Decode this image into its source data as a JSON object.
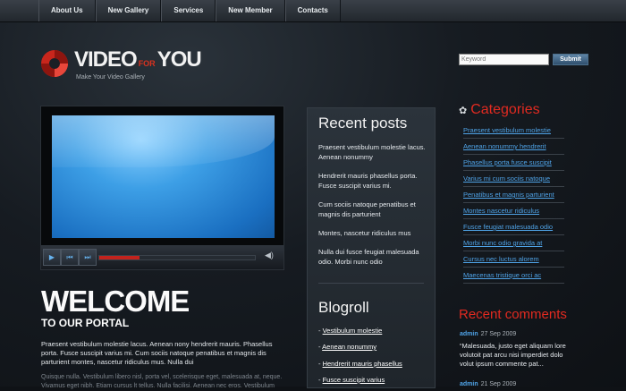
{
  "nav": [
    "About Us",
    "New Gallery",
    "Services",
    "New Member",
    "Contacts"
  ],
  "logo": {
    "video": "VIDEO",
    "for": "FOR",
    "you": "YOU",
    "tagline": "Make Your Video Gallery"
  },
  "search": {
    "placeholder": "Keyword",
    "button": "Submit"
  },
  "player": {
    "play_icon": "▶",
    "prev_icon": "⏮",
    "next_icon": "⏭",
    "volume_icon": "◀)",
    "progress": 0.26
  },
  "welcome": {
    "title": "WELCOME",
    "subtitle": "TO OUR PORTAL",
    "para1": "Praesent vestibulum molestie lacus. Aenean nony hendrerit mauris. Phasellus porta. Fusce suscipit varius mi. Cum sociis natoque penatibus et magnis dis parturient montes, nascetur ridiculus mus. Nulla dui",
    "para2": "Quisque nulla. Vestibulum libero nisl, porta vel, scelerisque eget, malesuada at, neque. Vivamus eget nibh. Etiam cursus lt tellus. Nulla facilisi. Aenean nec eros. Vestibulum"
  },
  "recent_posts": {
    "title": "Recent posts",
    "items": [
      "Praesent vestibulum molestie lacus. Aenean nonummy",
      "Hendrerit mauris phasellus porta. Fusce suscipit varius mi.",
      "Cum sociis natoque penatibus et magnis dis parturient",
      "Montes, nascetur ridiculus mus",
      "Nulla dui fusce feugiat malesuada odio. Morbi nunc odio"
    ]
  },
  "blogroll": {
    "title": "Blogroll",
    "items": [
      "Vestibulum molestie",
      "Aenean nonummy",
      "Hendrerit mauris phasellus",
      "Fusce suscipit varius"
    ]
  },
  "categories": {
    "title": "Categories",
    "items": [
      "Praesent vestibulum molestie",
      "Aenean nonummy hendrerit",
      "Phasellus porta fusce suscipit",
      "Varius mi cum sociis natoque",
      "Penatibus et magnis parturient",
      "Montes nascetur ridiculus",
      "Fusce feugiat malesuada odio",
      "Morbi nunc odio gravida at",
      "Cursus nec luctus alorem",
      "Maecenas tristique orci ac"
    ]
  },
  "recent_comments": {
    "title": "Recent comments",
    "items": [
      {
        "author": "admin",
        "date": "27 Sep 2009",
        "text": "“Malesuada, justo eget aliquam lore volutoit pat arcu nisi imperdiet dolo volut  ipsum commente pat..."
      },
      {
        "author": "admin",
        "date": "21 Sep 2009",
        "text": ""
      }
    ]
  },
  "colors": {
    "accent_red": "#e12a20",
    "link_blue": "#4fa3e7",
    "page_bg": "#0f1216"
  }
}
